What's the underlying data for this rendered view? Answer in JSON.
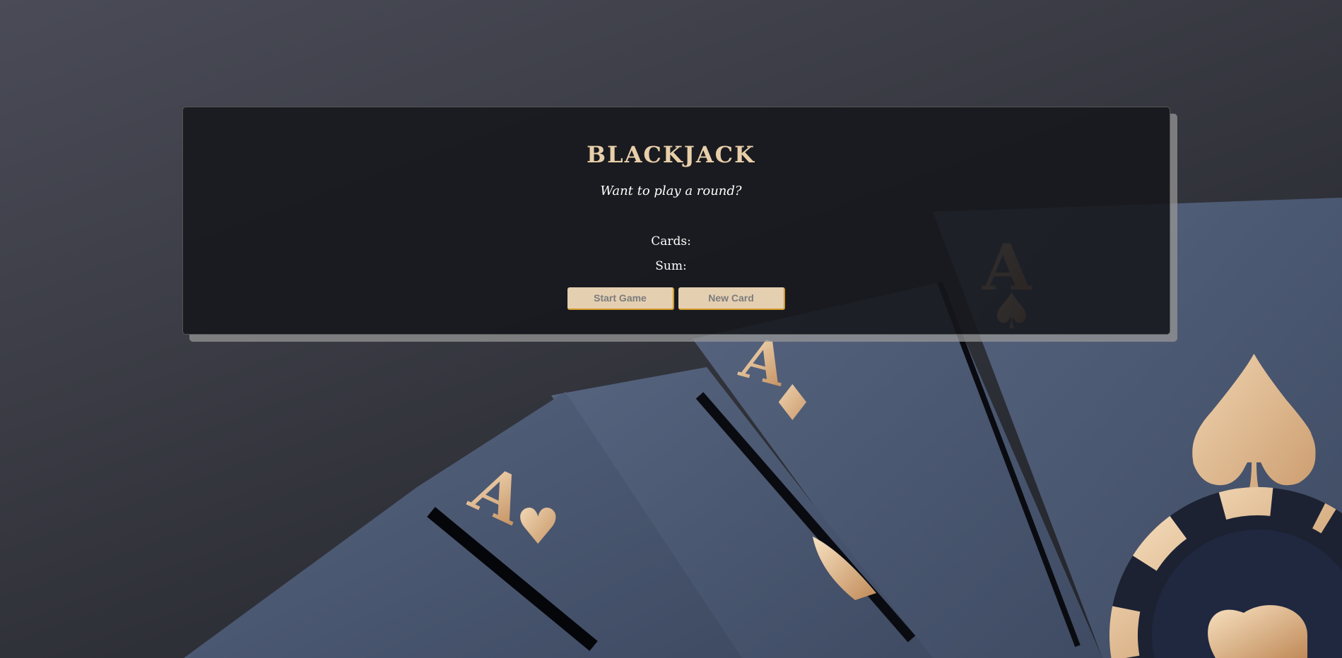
{
  "game": {
    "title": "BLACKJACK",
    "message": "Want to play a round?",
    "cards_label": "Cards:",
    "sum_label": "Sum:",
    "start_button": "Start Game",
    "new_card_button": "New Card"
  },
  "colors": {
    "accent": "#e8cfa9",
    "button_bg": "#e4cfb1",
    "button_border": "#d29a2a"
  }
}
